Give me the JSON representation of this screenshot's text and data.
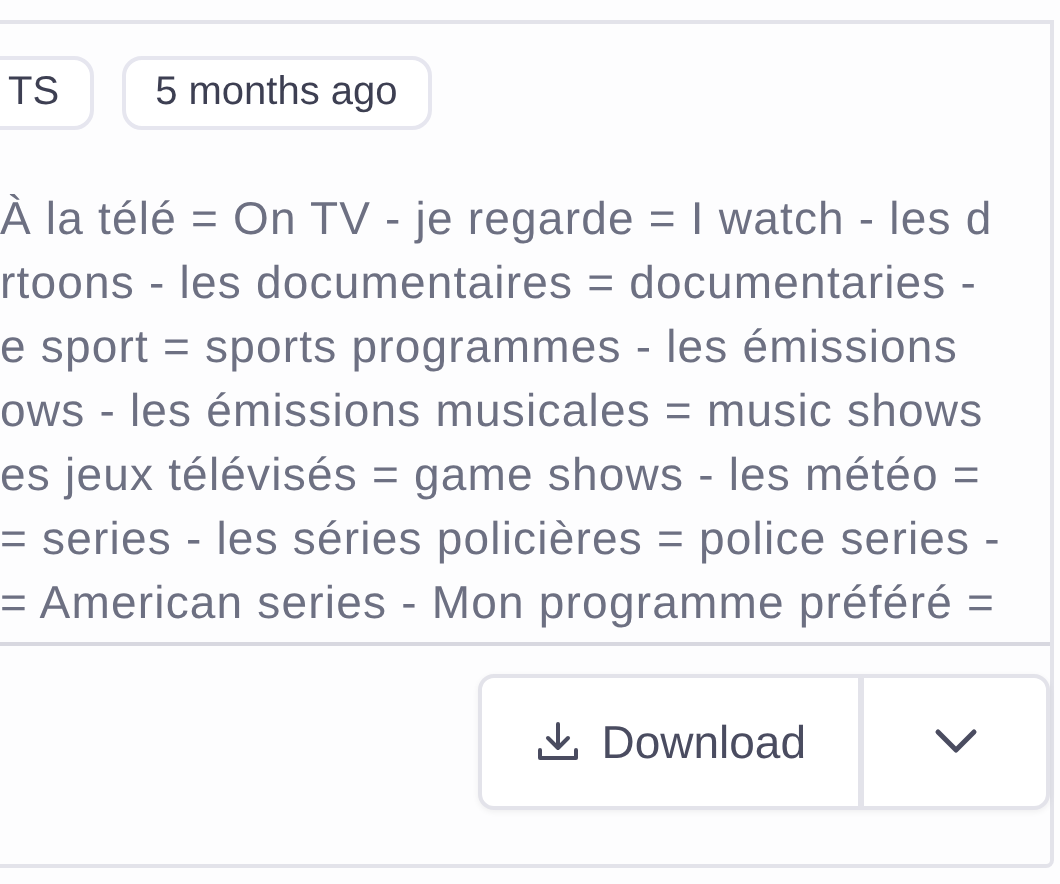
{
  "tags": [
    "TS",
    "5 months ago"
  ],
  "content_lines": [
    "À la télé = On TV - je regarde = I watch - les d",
    "rtoons - les documentaires = documentaries -",
    "e sport = sports programmes - les émissions",
    "ows - les émissions musicales = music shows",
    "es jeux télévisés = game shows - les météo =",
    "= series - les séries policières = police series -",
    "= American series - Mon programme préféré ="
  ],
  "download_button": {
    "label": "Download"
  }
}
